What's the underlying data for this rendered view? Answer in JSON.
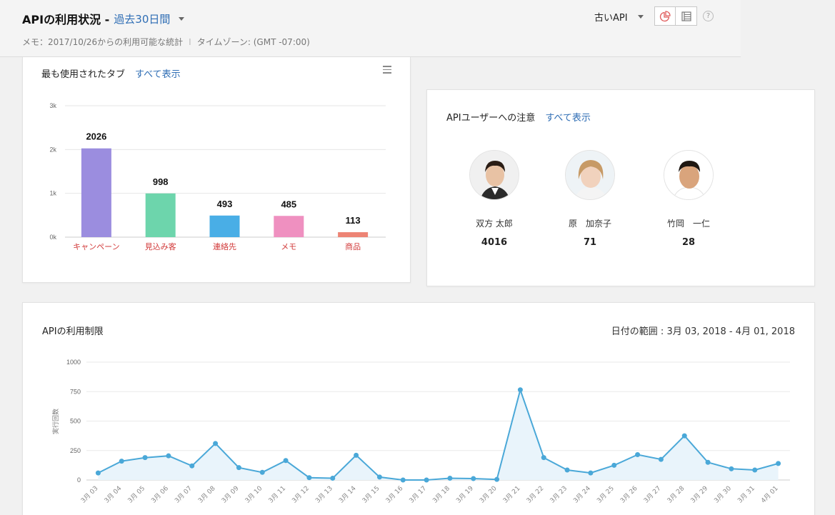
{
  "header": {
    "title": "APIの利用状況 -",
    "period": "過去30日間",
    "memo": "メモ：2017/10/26からの利用可能な統計",
    "separator": "I",
    "timezone": "タイムゾーン: (GMT -07:00)",
    "api_selector": "古いAPI",
    "help": "?"
  },
  "tabs_card": {
    "title": "最も使用されたタブ",
    "show_all": "すべて表示"
  },
  "users_card": {
    "title": "APIユーザーへの注意",
    "show_all": "すべて表示",
    "users": [
      {
        "name": "双方 太郎",
        "count": "4016"
      },
      {
        "name": "原　加奈子",
        "count": "71"
      },
      {
        "name": "竹岡　一仁",
        "count": "28"
      }
    ]
  },
  "limit_card": {
    "title": "APIの利用制限",
    "date_range": "日付の範囲 : 3月 03, 2018 - 4月 01, 2018"
  },
  "chart_data": [
    {
      "type": "bar",
      "categories": [
        "キャンペーン",
        "見込み客",
        "連絡先",
        "メモ",
        "商品"
      ],
      "values": [
        2026,
        998,
        493,
        485,
        113
      ],
      "value_labels": [
        "2026",
        "998",
        "493",
        "485",
        "113"
      ],
      "colors": [
        "#9b8ddf",
        "#6dd5ac",
        "#49aee6",
        "#ef90c0",
        "#ed8475"
      ],
      "ylim": [
        0,
        3000
      ],
      "yticks": [
        0,
        1000,
        2000,
        3000
      ],
      "ytick_labels": [
        "0k",
        "1k",
        "2k",
        "3k"
      ],
      "category_color": "#d23b3b",
      "grid": true
    },
    {
      "type": "area",
      "categories": [
        "3月 03",
        "3月 04",
        "3月 05",
        "3月 06",
        "3月 07",
        "3月 08",
        "3月 09",
        "3月 10",
        "3月 11",
        "3月 12",
        "3月 13",
        "3月 14",
        "3月 15",
        "3月 16",
        "3月 17",
        "3月 18",
        "3月 19",
        "3月 20",
        "3月 21",
        "3月 22",
        "3月 23",
        "3月 24",
        "3月 25",
        "3月 26",
        "3月 27",
        "3月 28",
        "3月 29",
        "3月 30",
        "3月 31",
        "4月 01"
      ],
      "values": [
        60,
        160,
        190,
        205,
        120,
        310,
        105,
        65,
        165,
        20,
        15,
        210,
        25,
        0,
        0,
        15,
        12,
        5,
        765,
        190,
        85,
        60,
        125,
        215,
        175,
        375,
        150,
        95,
        85,
        140
      ],
      "ylim": [
        0,
        1000
      ],
      "yticks": [
        0,
        250,
        500,
        750,
        1000
      ],
      "ytick_labels": [
        "0",
        "250",
        "500",
        "750",
        "1000"
      ],
      "ylabel": "実行回数",
      "line_color": "#4aa8d8",
      "fill_color": "#e9f4fb",
      "grid": true
    }
  ]
}
